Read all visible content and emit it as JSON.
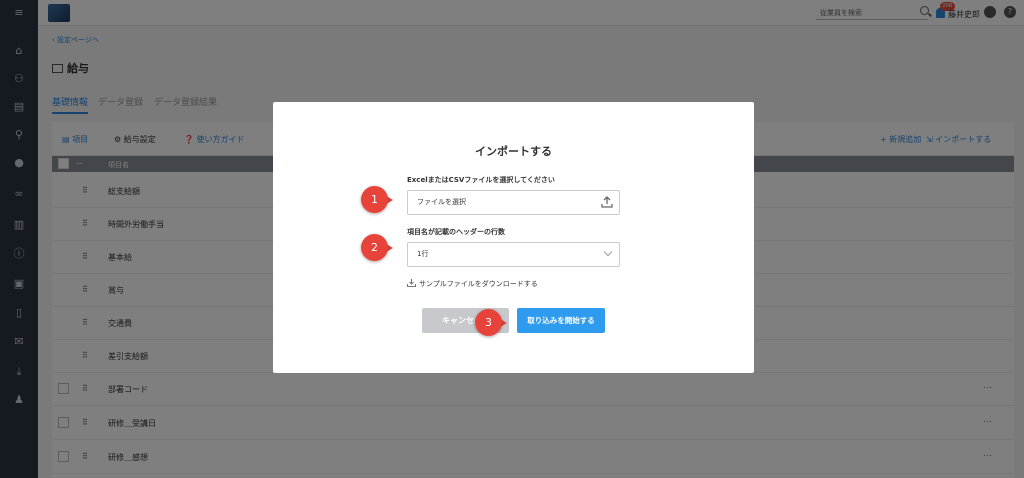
{
  "topbar": {
    "search_placeholder": "従業員を検索",
    "notification_count": "206",
    "user_name": "藤井史郎",
    "help_label": "?"
  },
  "sidebar": {
    "icons": [
      "menu-icon",
      "home-icon",
      "org-chart-icon",
      "document-icon",
      "search-icon",
      "chat-icon",
      "link-icon",
      "report-icon",
      "info-icon",
      "contact-card-icon",
      "book-icon",
      "mail-icon",
      "download-icon",
      "user-settings-icon"
    ]
  },
  "page": {
    "back_link": "設定ページへ",
    "title": "給与",
    "tabs": [
      "基礎情報",
      "データ登録",
      "データ登録結果"
    ]
  },
  "toolbar": {
    "items_label": "項目",
    "settings_label": "給与設定",
    "guide_label": "使い方ガイド",
    "add_label": "+ 新規追加",
    "import_label": "インポートする"
  },
  "table": {
    "header": "項目名",
    "rows": [
      {
        "label": "総支給額"
      },
      {
        "label": "時間外労働手当"
      },
      {
        "label": "基本給"
      },
      {
        "label": "賞与"
      },
      {
        "label": "交通費"
      },
      {
        "label": "差引支給額"
      },
      {
        "label": "部署コード"
      },
      {
        "label": "研修＿受講日"
      },
      {
        "label": "研修＿感想"
      }
    ],
    "more_label": "…"
  },
  "modal": {
    "title": "インポートする",
    "file_label": "ExcelまたはCSVファイルを選択してください",
    "file_placeholder": "ファイルを選択",
    "header_rows_label": "項目名が記載のヘッダーの行数",
    "header_rows_value": "1行",
    "download_label": "サンプルファイルをダウンロードする",
    "cancel_label": "キャンセル",
    "start_label": "取り込みを開始する"
  },
  "callouts": [
    "1",
    "2",
    "3"
  ],
  "colors": {
    "accent": "#2e9bef",
    "callout": "#e8433a",
    "sidebar": "#2b3442",
    "badge": "#e74c3c"
  }
}
